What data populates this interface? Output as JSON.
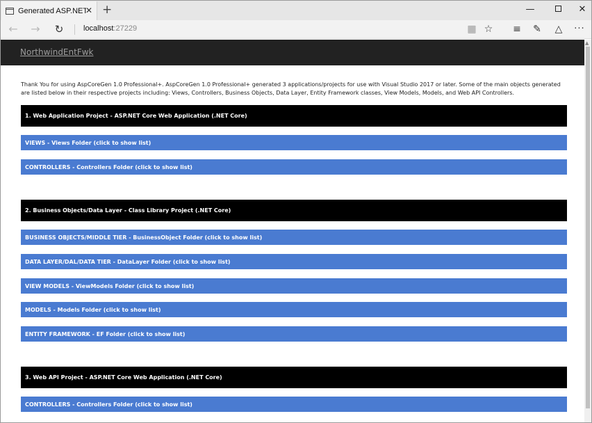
{
  "browser": {
    "tab_title": "Generated ASP.NET Cor",
    "tab_close": "✕",
    "new_tab": "+",
    "address_host": "localhost",
    "address_port": ":27229",
    "window_controls": {
      "minimize": "—",
      "close": "✕"
    },
    "icons": [
      "back-arrow-icon",
      "forward-arrow-icon",
      "refresh-icon",
      "reading-view-icon",
      "favorite-star-icon",
      "hub-icon",
      "web-note-icon",
      "share-icon",
      "more-icon"
    ]
  },
  "site": {
    "brand": "NorthwindEntFwk",
    "intro": "Thank You for using AspCoreGen 1.0 Professional+. AspCoreGen 1.0 Professional+ generated 3 applications/projects for use with Visual Studio 2017 or later. Some of the main objects generated are listed below in their respective projects including: Views, Controllers, Business Objects, Data Layer, Entity Framework classes, View Models, Models, and Web API Controllers."
  },
  "sections": [
    {
      "header": "1. Web Application Project - ASP.NET Core Web Application (.NET Core)",
      "folders": [
        "VIEWS - Views Folder (click to show list)",
        "CONTROLLERS - Controllers Folder (click to show list)"
      ]
    },
    {
      "header": "2. Business Objects/Data Layer - Class Library Project (.NET Core)",
      "folders": [
        "BUSINESS OBJECTS/MIDDLE TIER - BusinessObject Folder (click to show list)",
        "DATA LAYER/DAL/DATA TIER - DataLayer Folder (click to show list)",
        "VIEW MODELS - ViewModels Folder (click to show list)",
        "MODELS - Models Folder (click to show list)",
        "ENTITY FRAMEWORK - EF Folder (click to show list)"
      ]
    },
    {
      "header": "3. Web API Project - ASP.NET Core Web Application (.NET Core)",
      "folders": [
        "CONTROLLERS - Controllers Folder (click to show list)"
      ]
    }
  ],
  "colors": {
    "header_band": "#000000",
    "folder_band": "#4a7bd1",
    "navbar": "#222222"
  }
}
